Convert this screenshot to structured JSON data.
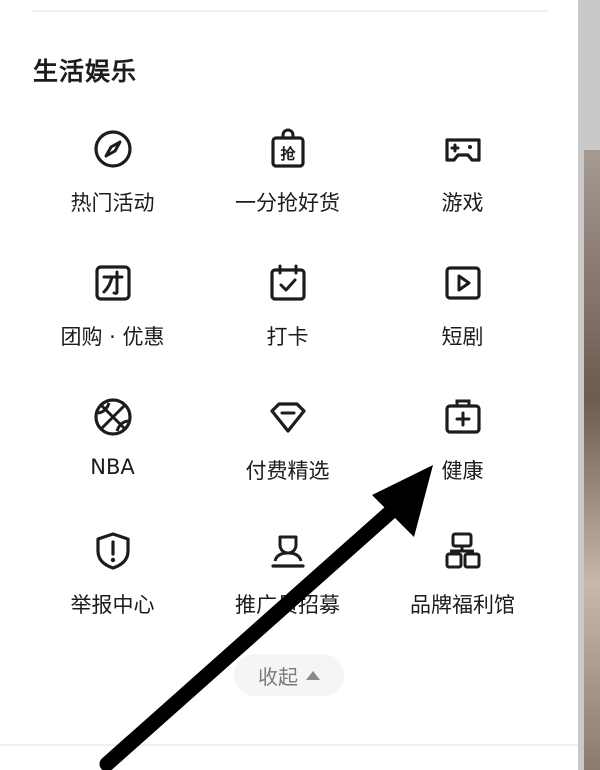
{
  "section": {
    "title": "生活娱乐"
  },
  "items": [
    {
      "label": "热门活动",
      "icon": "compass-icon"
    },
    {
      "label": "一分抢好货",
      "icon": "shopping-bag-icon"
    },
    {
      "label": "游戏",
      "icon": "gamepad-icon"
    },
    {
      "label": "团购 · 优惠",
      "icon": "group-buy-icon"
    },
    {
      "label": "打卡",
      "icon": "calendar-check-icon"
    },
    {
      "label": "短剧",
      "icon": "play-icon"
    },
    {
      "label": "NBA",
      "icon": "basketball-icon"
    },
    {
      "label": "付费精选",
      "icon": "diamond-icon"
    },
    {
      "label": "健康",
      "icon": "medical-kit-icon"
    },
    {
      "label": "举报中心",
      "icon": "shield-alert-icon"
    },
    {
      "label": "推广员招募",
      "icon": "user-icon"
    },
    {
      "label": "品牌福利馆",
      "icon": "brand-grid-icon"
    }
  ],
  "collapse": {
    "label": "收起"
  },
  "colors": {
    "text": "#1c1c1c",
    "muted": "#7a7a7a",
    "pill": "#f5f5f5",
    "annotation": "#000000"
  }
}
